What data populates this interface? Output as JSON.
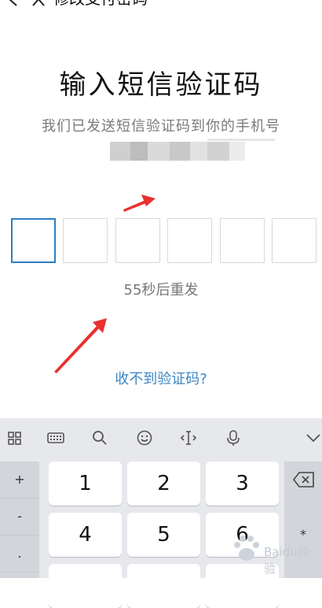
{
  "header": {
    "title": "修改支付密码"
  },
  "main": {
    "heading": "输入短信验证码",
    "subtitle": "我们已发送短信验证码到你的手机号",
    "countdown": "55秒后重发",
    "help_link": "收不到验证码?",
    "code_slots": 6
  },
  "keyboard": {
    "tools": [
      "grid-icon",
      "keypad-icon",
      "search-icon",
      "emoji-icon",
      "cursor-icon",
      "microphone-icon",
      "chevron-down-icon"
    ],
    "left_keys": [
      "+",
      "-",
      "."
    ],
    "keys": [
      "1",
      "2",
      "3",
      "4",
      "5",
      "6"
    ],
    "right_keys": [
      "*"
    ]
  },
  "colors": {
    "accent": "#2e7ec1",
    "link": "#3c86c5",
    "arrow": "#e8312f",
    "keyboard_bg": "#e7e8ec"
  },
  "watermark": {
    "text": "Baidu经验"
  }
}
